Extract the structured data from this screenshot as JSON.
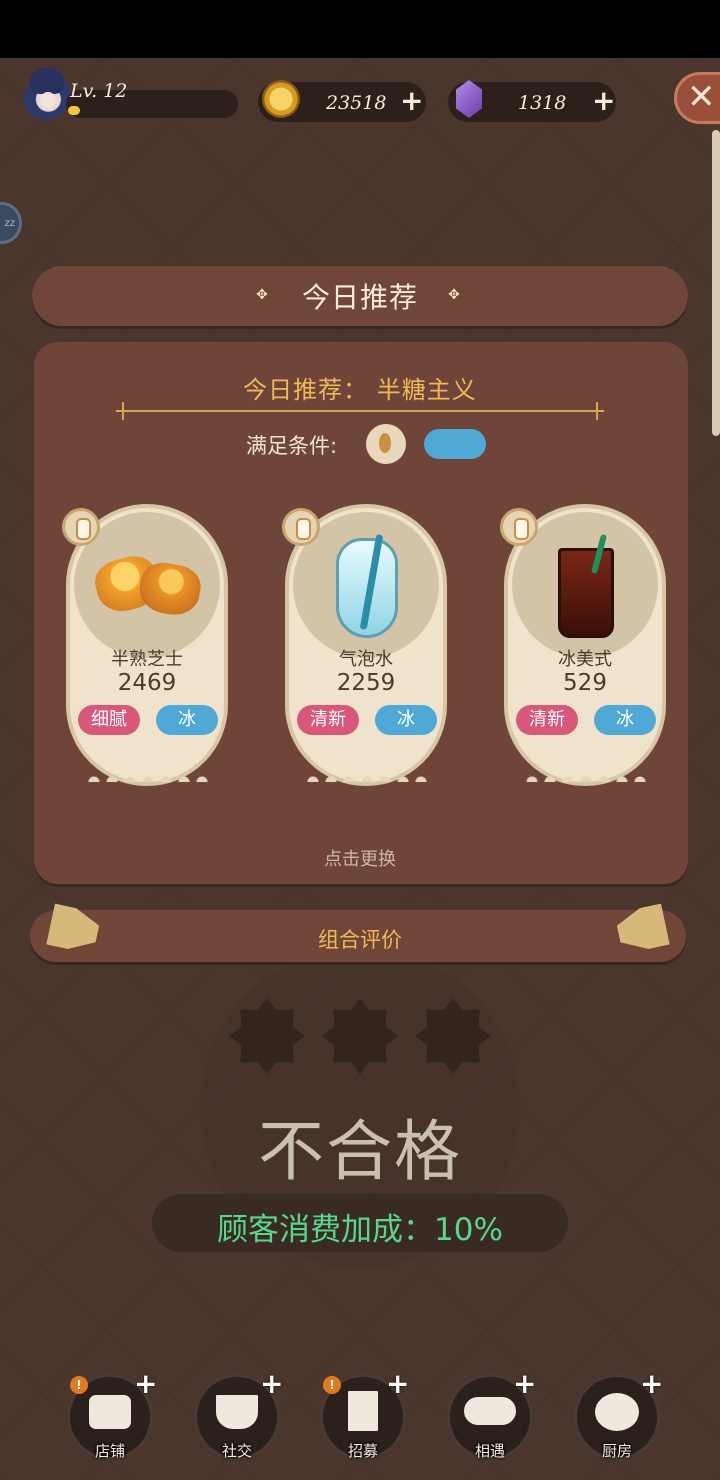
{
  "player": {
    "level_label": "Lv. 12",
    "level_progress_pct": 8
  },
  "currencies": {
    "coins": {
      "value": "23518",
      "plus": "+"
    },
    "gems": {
      "value": "1318",
      "plus": "+"
    }
  },
  "close_label": "✕",
  "side_bubble_label": "zz",
  "title": "今日推荐",
  "recommend": {
    "title": "今日推荐：   半糖主义",
    "condition_label": "满足条件:",
    "hint": "点击更换",
    "items": [
      {
        "name": "半熟芝士",
        "score": "2469",
        "tags": [
          "细腻",
          "冰"
        ]
      },
      {
        "name": "气泡水",
        "score": "2259",
        "tags": [
          "清新",
          "冰"
        ]
      },
      {
        "name": "冰美式",
        "score": "529",
        "tags": [
          "清新",
          "冰"
        ]
      }
    ]
  },
  "combo": {
    "title": "组合评价",
    "stars_filled": 0,
    "stars_total": 3,
    "grade": "不合格",
    "bonus": "顾客消费加成：10%"
  },
  "nav": [
    {
      "label": "店铺",
      "alert": "!",
      "plus": "+"
    },
    {
      "label": "社交",
      "plus": "+"
    },
    {
      "label": "招募",
      "alert": "!",
      "plus": "+"
    },
    {
      "label": "相遇",
      "plus": "+"
    },
    {
      "label": "厨房",
      "plus": "+"
    }
  ],
  "colors": {
    "accent_gold": "#f2b95a",
    "bonus_green": "#58d68a",
    "tag_pink": "#d9577a",
    "tag_blue": "#4fa9d4"
  }
}
